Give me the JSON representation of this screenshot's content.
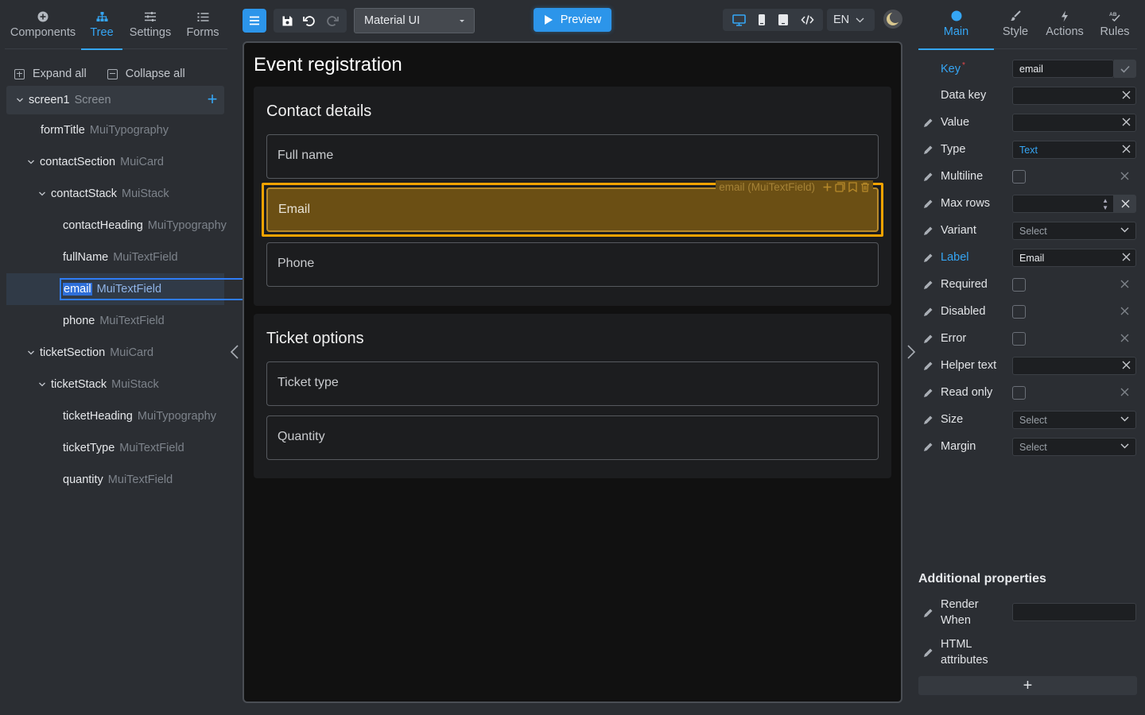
{
  "left_tabs": [
    {
      "label": "Components",
      "icon": "plus-circle-icon"
    },
    {
      "label": "Tree",
      "icon": "tree-icon"
    },
    {
      "label": "Settings",
      "icon": "sliders-icon"
    },
    {
      "label": "Forms",
      "icon": "list-icon"
    }
  ],
  "tree_actions": {
    "expand_all": "Expand all",
    "collapse_all": "Collapse all"
  },
  "tree": [
    {
      "name": "screen1",
      "type": "Screen"
    },
    {
      "name": "formTitle",
      "type": "MuiTypography"
    },
    {
      "name": "contactSection",
      "type": "MuiCard"
    },
    {
      "name": "contactStack",
      "type": "MuiStack"
    },
    {
      "name": "contactHeading",
      "type": "MuiTypography"
    },
    {
      "name": "fullName",
      "type": "MuiTextField"
    },
    {
      "name": "email",
      "type": "MuiTextField"
    },
    {
      "name": "phone",
      "type": "MuiTextField"
    },
    {
      "name": "ticketSection",
      "type": "MuiCard"
    },
    {
      "name": "ticketStack",
      "type": "MuiStack"
    },
    {
      "name": "ticketHeading",
      "type": "MuiTypography"
    },
    {
      "name": "ticketType",
      "type": "MuiTextField"
    },
    {
      "name": "quantity",
      "type": "MuiTextField"
    }
  ],
  "toolbar": {
    "library": "Material UI",
    "preview": "Preview",
    "language": "EN"
  },
  "canvas": {
    "form_title": "Event registration",
    "contact_heading": "Contact details",
    "ticket_heading": "Ticket options",
    "fields": {
      "full_name": "Full name",
      "email": "Email",
      "phone": "Phone",
      "ticket_type": "Ticket type",
      "quantity": "Quantity"
    },
    "selection_tag": "email (MuiTextField)"
  },
  "right_tabs": [
    {
      "label": "Main",
      "icon": "circle-icon"
    },
    {
      "label": "Style",
      "icon": "brush-icon"
    },
    {
      "label": "Actions",
      "icon": "lightning-icon"
    },
    {
      "label": "Rules",
      "icon": "rules-icon"
    }
  ],
  "props": {
    "key": {
      "label": "Key",
      "value": "email"
    },
    "data_key": {
      "label": "Data key"
    },
    "value": {
      "label": "Value"
    },
    "type": {
      "label": "Type",
      "value": "Text"
    },
    "multiline": {
      "label": "Multiline"
    },
    "max_rows": {
      "label": "Max rows"
    },
    "variant": {
      "label": "Variant",
      "value": "Select"
    },
    "label": {
      "label": "Label",
      "value": "Email"
    },
    "required": {
      "label": "Required"
    },
    "disabled": {
      "label": "Disabled"
    },
    "error": {
      "label": "Error"
    },
    "helper_text": {
      "label": "Helper text"
    },
    "read_only": {
      "label": "Read only"
    },
    "size": {
      "label": "Size",
      "value": "Select"
    },
    "margin": {
      "label": "Margin",
      "value": "Select"
    }
  },
  "additional": {
    "title": "Additional properties",
    "render_when": "Render When",
    "html_attributes": "HTML attributes",
    "add_label": "+"
  },
  "colors": {
    "accent": "#35a6f5",
    "highlight": "#f5a300",
    "selection": "#2f7cf6"
  }
}
